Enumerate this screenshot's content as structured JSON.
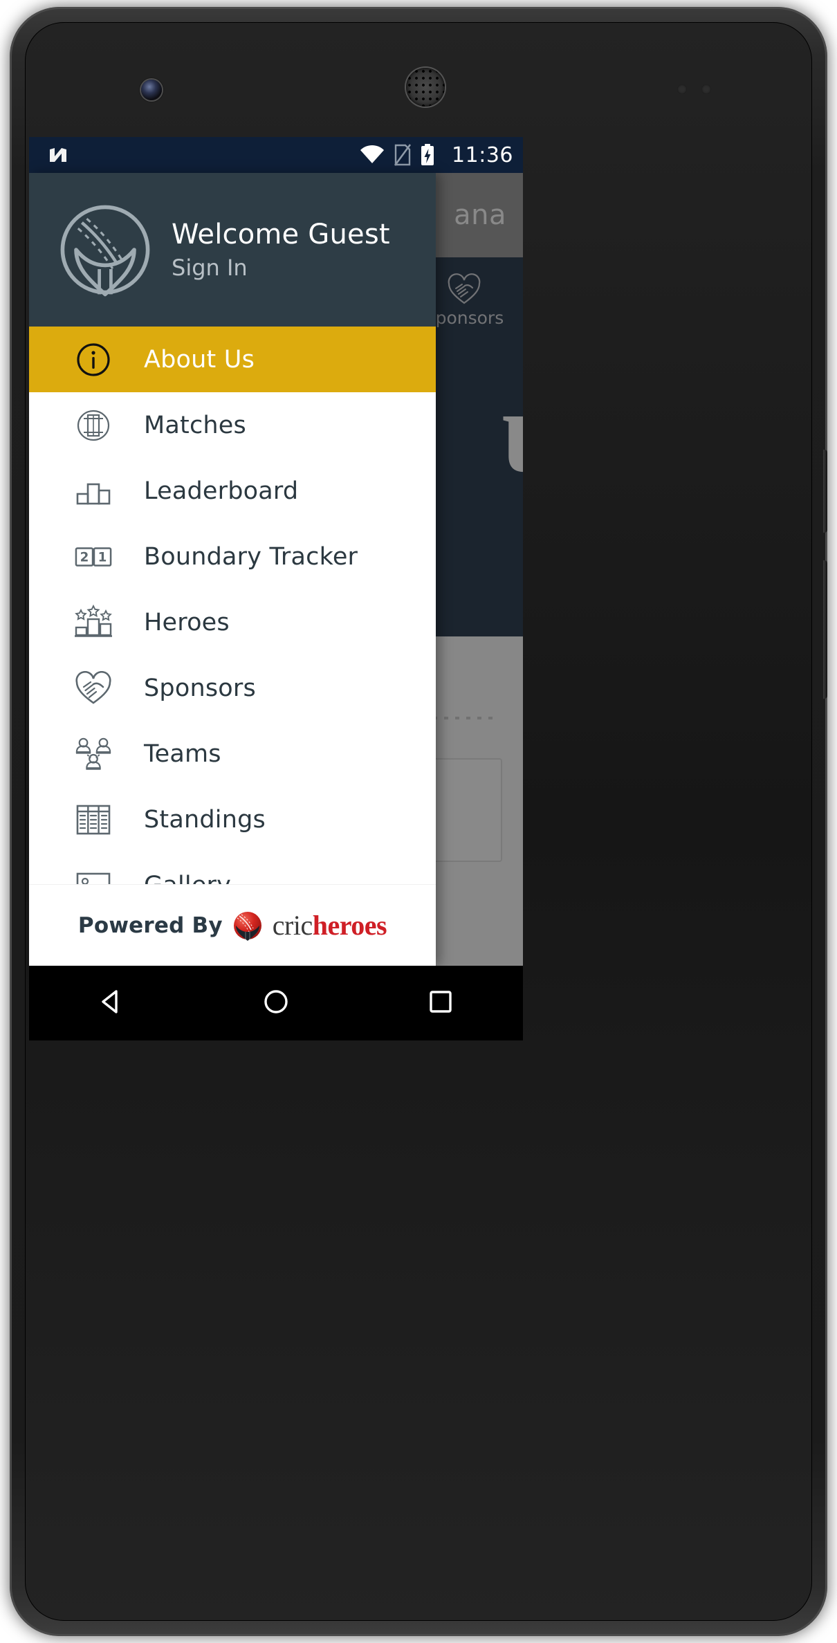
{
  "status_bar": {
    "android_n_logo": "N",
    "icons": [
      "wifi-icon",
      "sim-card-off-icon",
      "battery-charging-icon"
    ],
    "time": "11:36"
  },
  "background_app": {
    "app_bar_title": "ana",
    "tab": {
      "label": "Sponsors",
      "icon": "handshake-heart-icon"
    },
    "hero_logo_text": "ub"
  },
  "drawer": {
    "header": {
      "avatar_icon": "cricheroes-ball-helmet-icon",
      "welcome_text": "Welcome Guest",
      "sign_in_text": "Sign In"
    },
    "items": [
      {
        "label": "About Us",
        "icon": "info-circle-icon",
        "active": true
      },
      {
        "label": "Matches",
        "icon": "cricket-pitch-icon",
        "active": false
      },
      {
        "label": "Leaderboard",
        "icon": "podium-bars-icon",
        "active": false
      },
      {
        "label": "Boundary Tracker",
        "icon": "two-one-boxes-icon",
        "active": false
      },
      {
        "label": "Heroes",
        "icon": "podium-stars-icon",
        "active": false
      },
      {
        "label": "Sponsors",
        "icon": "handshake-heart-icon",
        "active": false
      },
      {
        "label": "Teams",
        "icon": "three-people-icon",
        "active": false
      },
      {
        "label": "Standings",
        "icon": "table-columns-icon",
        "active": false
      },
      {
        "label": "Gallery",
        "icon": "photo-frame-icon",
        "active": false
      }
    ],
    "footer": {
      "powered_by": "Powered By",
      "brand_first": "cric",
      "brand_second": "heroes",
      "brand_ball_icon": "cricheroes-ball-icon"
    }
  },
  "nav_bar": {
    "back": "back-triangle-icon",
    "home": "home-circle-icon",
    "recents": "recents-square-icon"
  },
  "colors": {
    "accent_yellow": "#dcab0e",
    "drawer_header": "#2e3d46",
    "status_bar": "#0e1f38",
    "brand_red": "#cf1f26"
  }
}
